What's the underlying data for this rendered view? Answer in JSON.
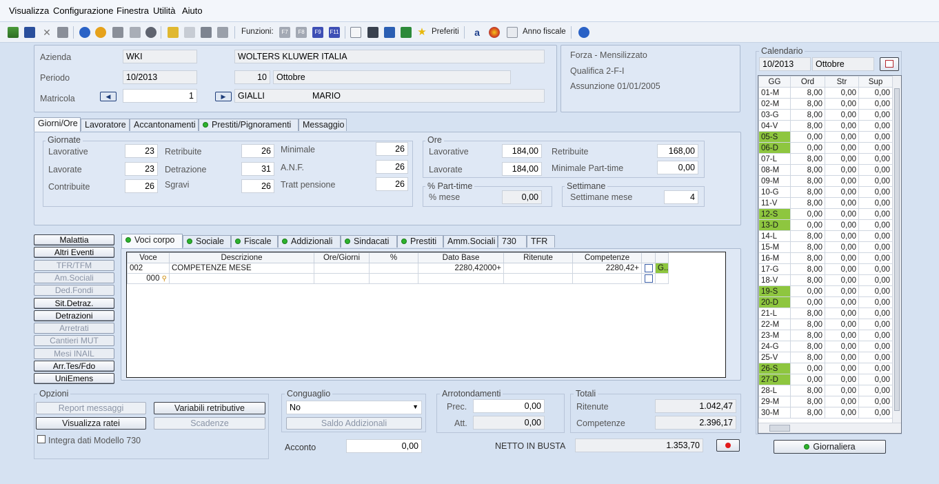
{
  "menu": [
    "Visualizza",
    "Configurazione",
    "Finestra",
    "Utilità",
    "Aiuto"
  ],
  "toolbar": {
    "funzioni_label": "Funzioni:",
    "f_keys": [
      "F7",
      "F8",
      "F9",
      "F11"
    ],
    "preferiti": "Preferiti",
    "anno_fiscale": "Anno fiscale"
  },
  "header": {
    "azienda_label": "Azienda",
    "azienda_code": "WKI",
    "azienda_name": "WOLTERS KLUWER ITALIA",
    "periodo_label": "Periodo",
    "periodo_value": "10/2013",
    "month_num": "10",
    "month_name": "Ottobre",
    "matricola_label": "Matricola",
    "matricola_value": "1",
    "surname": "GIALLI",
    "name": "MARIO",
    "info1": "Forza - Mensilizzato",
    "info2": "Qualifica 2-F-I",
    "info3": "Assunzione 01/01/2005"
  },
  "main_tabs": [
    "Giorni/Ore",
    "Lavoratore",
    "Accantonamenti",
    "Prestiti/Pignoramenti",
    "Messaggio"
  ],
  "giornate": {
    "title": "Giornate",
    "lavorative_label": "Lavorative",
    "lavorative": "23",
    "lavorate_label": "Lavorate",
    "lavorate": "23",
    "contribuite_label": "Contribuite",
    "contribuite": "26",
    "retribuite_label": "Retribuite",
    "retribuite": "26",
    "detrazione_label": "Detrazione",
    "detrazione": "31",
    "sgravi_label": "Sgravi",
    "sgravi": "26",
    "minimale_label": "Minimale",
    "minimale": "26",
    "anf_label": "A.N.F.",
    "anf": "26",
    "tratt_label": "Tratt pensione",
    "tratt": "26"
  },
  "ore": {
    "title": "Ore",
    "lavorative_label": "Lavorative",
    "lavorative": "184,00",
    "lavorate_label": "Lavorate",
    "lavorate": "184,00",
    "retribuite_label": "Retribuite",
    "retribuite": "168,00",
    "minimale_label": "Minimale Part-time",
    "minimale": "0,00"
  },
  "parttime": {
    "title": "% Part-time",
    "label": "% mese",
    "value": "0,00"
  },
  "settimane": {
    "title": "Settimane",
    "label": "Settimane mese",
    "value": "4"
  },
  "side_buttons": [
    {
      "label": "Malattia",
      "enabled": true
    },
    {
      "label": "Altri Eventi",
      "enabled": true
    },
    {
      "label": "TFR/TFM",
      "enabled": false
    },
    {
      "label": "Am.Sociali",
      "enabled": false
    },
    {
      "label": "Ded.Fondi",
      "enabled": false
    },
    {
      "label": "Sit.Detraz.",
      "enabled": true
    },
    {
      "label": "Detrazioni",
      "enabled": true
    },
    {
      "label": "Arretrati",
      "enabled": false
    },
    {
      "label": "Cantieri MUT",
      "enabled": false
    },
    {
      "label": "Mesi INAIL",
      "enabled": false
    },
    {
      "label": "Arr.Tes/Fdo",
      "enabled": true
    },
    {
      "label": "UniEmens",
      "enabled": true
    }
  ],
  "voci_tabs": [
    "Voci corpo",
    "Sociale",
    "Fiscale",
    "Addizionali",
    "Sindacati",
    "Prestiti",
    "Amm.Sociali",
    "730",
    "TFR"
  ],
  "grid": {
    "columns": [
      "Voce",
      "Descrizione",
      "Ore/Giorni",
      "%",
      "Dato Base",
      "Ritenute",
      "Competenze"
    ],
    "rows": [
      {
        "voce": "002",
        "descr": "COMPETENZE MESE",
        "ore": "",
        "perc": "",
        "base": "2280,42000+",
        "rit": "",
        "comp": "2280,42+",
        "flag": "G..."
      },
      {
        "voce": "000",
        "descr": "",
        "ore": "",
        "perc": "",
        "base": "",
        "rit": "",
        "comp": "",
        "flag": ""
      }
    ]
  },
  "opzioni": {
    "title": "Opzioni",
    "report": "Report messaggi",
    "variabili": "Variabili retributive",
    "ratei": "Visualizza ratei",
    "scadenze": "Scadenze",
    "integra": "Integra dati Modello 730"
  },
  "conguaglio": {
    "title": "Conguaglio",
    "value": "No",
    "saldo": "Saldo Addizionali",
    "acconto_label": "Acconto",
    "acconto": "0,00"
  },
  "arrotondamenti": {
    "title": "Arrotondamenti",
    "prec_label": "Prec.",
    "prec": "0,00",
    "att_label": "Att.",
    "att": "0,00"
  },
  "totali": {
    "title": "Totali",
    "ritenute_label": "Ritenute",
    "ritenute": "1.042,47",
    "competenze_label": "Competenze",
    "competenze": "2.396,17",
    "netto_label": "NETTO IN BUSTA",
    "netto": "1.353,70"
  },
  "calendar": {
    "title": "Calendario",
    "period": "10/2013",
    "month": "Ottobre",
    "columns": [
      "GG",
      "Ord",
      "Str",
      "Sup"
    ],
    "rows": [
      [
        "01-M",
        "8,00",
        "0,00",
        "0,00",
        false
      ],
      [
        "02-M",
        "8,00",
        "0,00",
        "0,00",
        false
      ],
      [
        "03-G",
        "8,00",
        "0,00",
        "0,00",
        false
      ],
      [
        "04-V",
        "8,00",
        "0,00",
        "0,00",
        false
      ],
      [
        "05-S",
        "0,00",
        "0,00",
        "0,00",
        true
      ],
      [
        "06-D",
        "0,00",
        "0,00",
        "0,00",
        true
      ],
      [
        "07-L",
        "8,00",
        "0,00",
        "0,00",
        false
      ],
      [
        "08-M",
        "8,00",
        "0,00",
        "0,00",
        false
      ],
      [
        "09-M",
        "8,00",
        "0,00",
        "0,00",
        false
      ],
      [
        "10-G",
        "8,00",
        "0,00",
        "0,00",
        false
      ],
      [
        "11-V",
        "8,00",
        "0,00",
        "0,00",
        false
      ],
      [
        "12-S",
        "0,00",
        "0,00",
        "0,00",
        true
      ],
      [
        "13-D",
        "0,00",
        "0,00",
        "0,00",
        true
      ],
      [
        "14-L",
        "8,00",
        "0,00",
        "0,00",
        false
      ],
      [
        "15-M",
        "8,00",
        "0,00",
        "0,00",
        false
      ],
      [
        "16-M",
        "8,00",
        "0,00",
        "0,00",
        false
      ],
      [
        "17-G",
        "8,00",
        "0,00",
        "0,00",
        false
      ],
      [
        "18-V",
        "8,00",
        "0,00",
        "0,00",
        false
      ],
      [
        "19-S",
        "0,00",
        "0,00",
        "0,00",
        true
      ],
      [
        "20-D",
        "0,00",
        "0,00",
        "0,00",
        true
      ],
      [
        "21-L",
        "8,00",
        "0,00",
        "0,00",
        false
      ],
      [
        "22-M",
        "8,00",
        "0,00",
        "0,00",
        false
      ],
      [
        "23-M",
        "8,00",
        "0,00",
        "0,00",
        false
      ],
      [
        "24-G",
        "8,00",
        "0,00",
        "0,00",
        false
      ],
      [
        "25-V",
        "8,00",
        "0,00",
        "0,00",
        false
      ],
      [
        "26-S",
        "0,00",
        "0,00",
        "0,00",
        true
      ],
      [
        "27-D",
        "0,00",
        "0,00",
        "0,00",
        true
      ],
      [
        "28-L",
        "8,00",
        "0,00",
        "0,00",
        false
      ],
      [
        "29-M",
        "8,00",
        "0,00",
        "0,00",
        false
      ],
      [
        "30-M",
        "8,00",
        "0,00",
        "0,00",
        false
      ]
    ],
    "giornaliera": "Giornaliera"
  }
}
